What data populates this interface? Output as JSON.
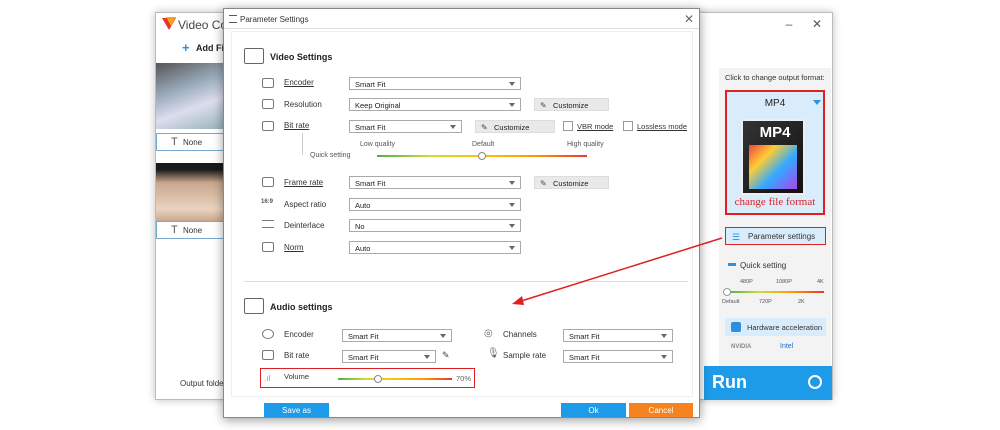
{
  "main_window": {
    "title": "Video Con",
    "add_files": "Add File",
    "subtitle_items": [
      "None",
      "None"
    ],
    "output_folder_label": "Output folder:",
    "run_label": "Run"
  },
  "right_panel": {
    "click_text": "Click to change output format:",
    "format_name": "MP4",
    "format_icon_text": "MP4",
    "annotation": "change file format",
    "parameter_settings": "Parameter settings",
    "quick_setting": "Quick setting",
    "ticks_top": [
      "480P",
      "1080P",
      "4K"
    ],
    "ticks_bottom": [
      "Default",
      "720P",
      "2K"
    ],
    "hardware_acceleration": "Hardware acceleration",
    "nvidia": "NVIDIA",
    "intel": "Intel"
  },
  "dialog": {
    "title": "Parameter Settings",
    "video": {
      "section_title": "Video Settings",
      "encoder": {
        "label": "Encoder",
        "value": "Smart Fit"
      },
      "resolution": {
        "label": "Resolution",
        "value": "Keep Original",
        "customize": "Customize"
      },
      "bitrate": {
        "label": "Bit rate",
        "value": "Smart Fit",
        "customize": "Customize",
        "vbr": "VBR mode",
        "lossless": "Lossless mode"
      },
      "quick_setting": {
        "label": "Quick setting",
        "low": "Low quality",
        "default": "Default",
        "high": "High quality",
        "level": 0.5
      },
      "frame_rate": {
        "label": "Frame rate",
        "value": "Smart Fit",
        "customize": "Customize"
      },
      "aspect_ratio": {
        "label": "Aspect ratio",
        "value": "Auto"
      },
      "deinterlace": {
        "label": "Deinterlace",
        "value": "No"
      },
      "norm": {
        "label": "Norm",
        "value": "Auto"
      }
    },
    "audio": {
      "section_title": "Audio settings",
      "encoder": {
        "label": "Encoder",
        "value": "Smart Fit"
      },
      "bitrate": {
        "label": "Bit rate",
        "value": "Smart Fit"
      },
      "channels": {
        "label": "Channels",
        "value": "Smart Fit"
      },
      "sample_rate": {
        "label": "Sample rate",
        "value": "Smart Fit"
      },
      "volume": {
        "label": "Volume",
        "value": "70%",
        "level": 0.35
      }
    },
    "buttons": {
      "save_as": "Save as",
      "ok": "Ok",
      "cancel": "Cancel"
    }
  },
  "colors": {
    "accent_blue": "#1e9be8",
    "highlight_red": "#e02020",
    "cancel_orange": "#f5831f"
  }
}
